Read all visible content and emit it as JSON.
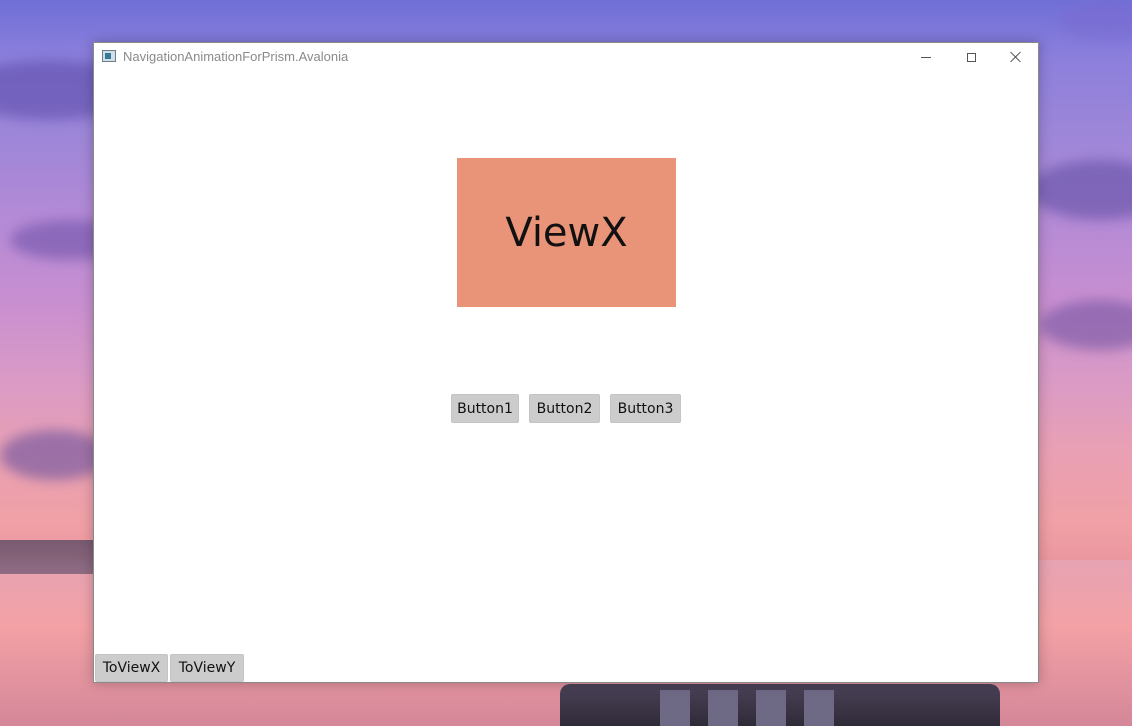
{
  "window": {
    "title": "NavigationAnimationForPrism.Avalonia",
    "controls": {
      "minimize_icon": "minimize-icon",
      "maximize_icon": "maximize-icon",
      "close_icon": "close-icon"
    }
  },
  "content": {
    "view_label": "ViewX",
    "view_color": "#e99478",
    "buttons": [
      "Button1",
      "Button2",
      "Button3"
    ]
  },
  "nav": {
    "to_view_x": "ToViewX",
    "to_view_y": "ToViewY"
  }
}
